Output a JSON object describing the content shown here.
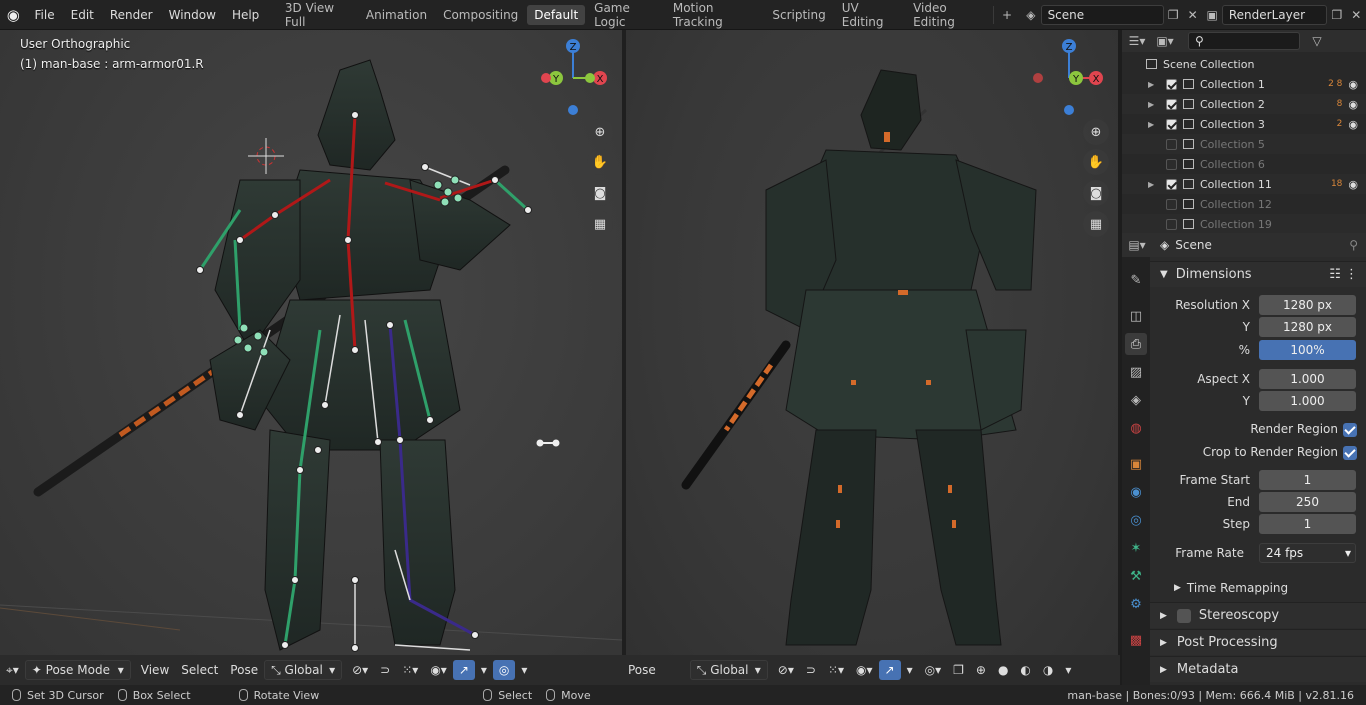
{
  "topbar": {
    "menus": [
      "File",
      "Edit",
      "Render",
      "Window",
      "Help"
    ],
    "workspaces": [
      "3D View Full",
      "Animation",
      "Compositing",
      "Default",
      "Game Logic",
      "Motion Tracking",
      "Scripting",
      "UV Editing",
      "Video Editing"
    ],
    "active_workspace": "Default",
    "add_label": "+",
    "scene": "Scene",
    "render_layer": "RenderLayer"
  },
  "viewport_left": {
    "view_name": "User Orthographic",
    "object_info": "(1) man-base : arm-armor01.R",
    "gizmo": {
      "x": "X",
      "y": "Y",
      "z": "Z"
    }
  },
  "viewport_right": {
    "gizmo": {
      "x": "X",
      "y": "Y",
      "z": "Z"
    }
  },
  "header_left": {
    "mode": "Pose Mode",
    "view": "View",
    "select": "Select",
    "pose": "Pose",
    "orientation": "Global"
  },
  "header_right": {
    "pose": "Pose",
    "orientation": "Global"
  },
  "outliner": {
    "root": "Scene Collection",
    "items": [
      {
        "label": "Collection 1",
        "checked": true,
        "expand": true,
        "badges": "2 8"
      },
      {
        "label": "Collection 2",
        "checked": true,
        "expand": true,
        "badges": "8"
      },
      {
        "label": "Collection 3",
        "checked": true,
        "expand": true,
        "badges": "2"
      },
      {
        "label": "Collection 5",
        "checked": false,
        "expand": false,
        "badges": ""
      },
      {
        "label": "Collection 6",
        "checked": false,
        "expand": false,
        "badges": ""
      },
      {
        "label": "Collection 11",
        "checked": true,
        "expand": true,
        "badges": "18"
      },
      {
        "label": "Collection 12",
        "checked": false,
        "expand": false,
        "badges": ""
      },
      {
        "label": "Collection 19",
        "checked": false,
        "expand": false,
        "badges": ""
      }
    ]
  },
  "properties": {
    "context": "Scene",
    "dimensions_title": "Dimensions",
    "resolution_x_label": "Resolution X",
    "resolution_x": "1280 px",
    "resolution_y_label": "Y",
    "resolution_y": "1280 px",
    "percent_label": "%",
    "percent": "100%",
    "percent_value": 1.0,
    "aspect_x_label": "Aspect X",
    "aspect_x": "1.000",
    "aspect_y_label": "Y",
    "aspect_y": "1.000",
    "render_region": "Render Region",
    "crop_region": "Crop to Render Region",
    "frame_start_label": "Frame Start",
    "frame_start": "1",
    "end_label": "End",
    "end": "250",
    "step_label": "Step",
    "step": "1",
    "frame_rate_label": "Frame Rate",
    "frame_rate": "24 fps",
    "time_remapping": "Time Remapping",
    "stereoscopy": "Stereoscopy",
    "post_processing": "Post Processing",
    "metadata": "Metadata"
  },
  "status": {
    "set_cursor": "Set 3D Cursor",
    "box_select": "Box Select",
    "rotate_view": "Rotate View",
    "select": "Select",
    "move": "Move",
    "info": "man-base | Bones:0/93 | Mem: 666.4 MiB | v2.81.16"
  },
  "colors": {
    "accent": "#4772b3",
    "axis_x": "#e0454f",
    "axis_y": "#8cc63e",
    "axis_z": "#3c7fd6",
    "bone_red": "#b01818",
    "bone_green": "#2fa06a",
    "bone_purple": "#3a2a8a",
    "orange": "#d46a2a"
  }
}
